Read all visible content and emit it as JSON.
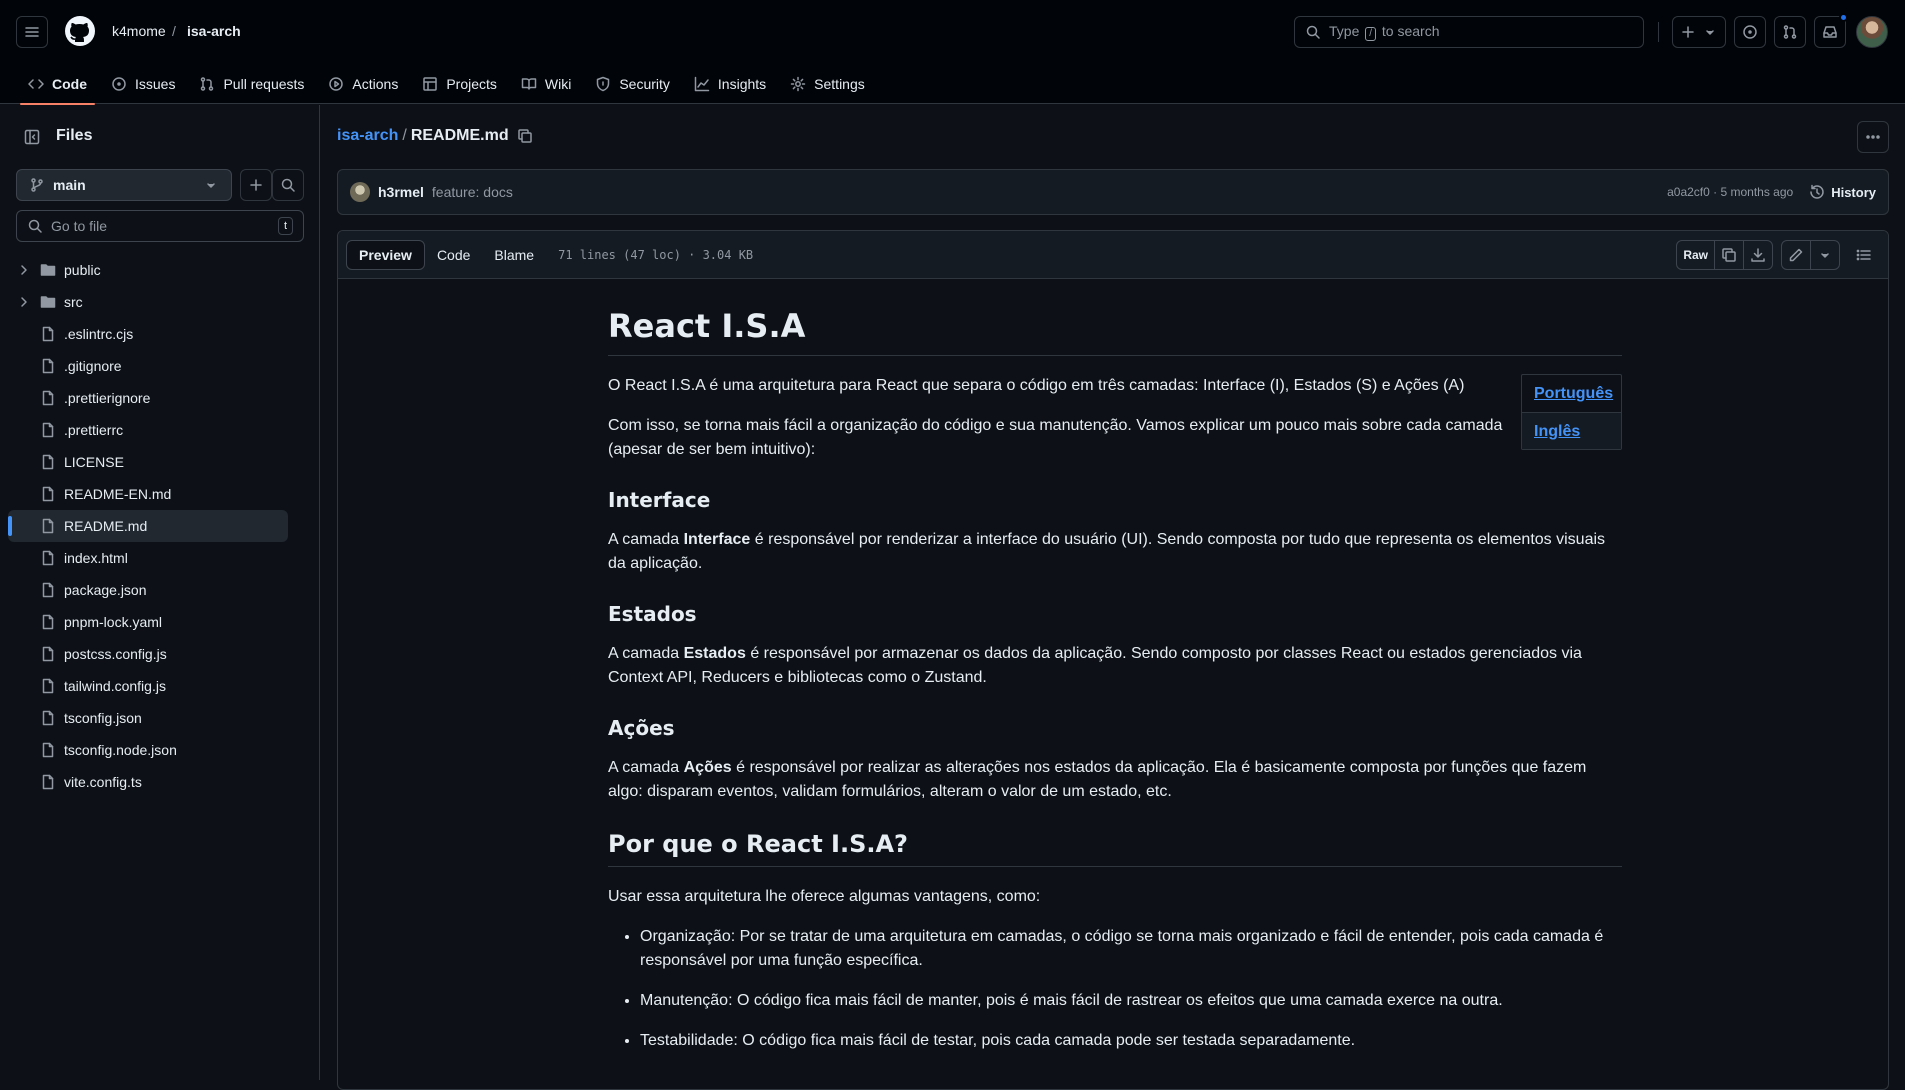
{
  "header": {
    "owner": "k4mome",
    "separator": "/",
    "repo": "isa-arch",
    "search": {
      "pre": "Type",
      "key": "/",
      "post": "to search"
    }
  },
  "nav_tabs": [
    {
      "label": "Code",
      "icon": "code-icon",
      "active": true
    },
    {
      "label": "Issues",
      "icon": "issue-icon"
    },
    {
      "label": "Pull requests",
      "icon": "pull-request-icon"
    },
    {
      "label": "Actions",
      "icon": "play-icon"
    },
    {
      "label": "Projects",
      "icon": "table-icon"
    },
    {
      "label": "Wiki",
      "icon": "book-icon"
    },
    {
      "label": "Security",
      "icon": "shield-icon"
    },
    {
      "label": "Insights",
      "icon": "graph-icon"
    },
    {
      "label": "Settings",
      "icon": "gear-icon"
    }
  ],
  "sidebar": {
    "title": "Files",
    "branch": "main",
    "goto_placeholder": "Go to file",
    "goto_key": "t",
    "items": [
      {
        "name": "public",
        "type": "folder"
      },
      {
        "name": "src",
        "type": "folder"
      },
      {
        "name": ".eslintrc.cjs",
        "type": "file"
      },
      {
        "name": ".gitignore",
        "type": "file"
      },
      {
        "name": ".prettierignore",
        "type": "file"
      },
      {
        "name": ".prettierrc",
        "type": "file"
      },
      {
        "name": "LICENSE",
        "type": "file"
      },
      {
        "name": "README-EN.md",
        "type": "file"
      },
      {
        "name": "README.md",
        "type": "file",
        "selected": true
      },
      {
        "name": "index.html",
        "type": "file"
      },
      {
        "name": "package.json",
        "type": "file"
      },
      {
        "name": "pnpm-lock.yaml",
        "type": "file"
      },
      {
        "name": "postcss.config.js",
        "type": "file"
      },
      {
        "name": "tailwind.config.js",
        "type": "file"
      },
      {
        "name": "tsconfig.json",
        "type": "file"
      },
      {
        "name": "tsconfig.node.json",
        "type": "file"
      },
      {
        "name": "vite.config.ts",
        "type": "file"
      }
    ]
  },
  "main": {
    "breadcrumb_repo": "isa-arch",
    "breadcrumb_sep": "/",
    "breadcrumb_file": "README.md",
    "commit": {
      "author": "h3rmel",
      "message": "feature: docs",
      "meta": "a0a2cf0 · 5 months ago",
      "history_label": "History"
    },
    "toolbar": {
      "preview": "Preview",
      "code": "Code",
      "blame": "Blame",
      "info": "71 lines (47 loc) · 3.04 KB",
      "raw": "Raw"
    },
    "readme": {
      "title": "React I.S.A",
      "intro_1": "O React I.S.A é uma arquitetura para React que separa o código em três camadas: Interface (I), Estados (S) e Ações (A)",
      "intro_2": "Com isso, se torna mais fácil a organização do código e sua manutenção. Vamos explicar um pouco mais sobre cada camada (apesar de ser bem intuitivo):",
      "lang_pt": "Português",
      "lang_en": "Inglês",
      "interface_title": "Interface",
      "interface_pre": "A camada",
      "interface_bold": "Interface",
      "interface_post": "é responsável por renderizar a interface do usuário (UI). Sendo composta por tudo que representa os elementos visuais da aplicação.",
      "estados_title": "Estados",
      "estados_pre": "A camada",
      "estados_bold": "Estados",
      "estados_post": "é responsável por armazenar os dados da aplicação. Sendo composto por classes React ou estados gerenciados via Context API, Reducers e bibliotecas como o Zustand.",
      "acoes_title": "Ações",
      "acoes_pre": "A camada",
      "acoes_bold": "Ações",
      "acoes_post": "é responsável por realizar as alterações nos estados da aplicação. Ela é basicamente composta por funções que fazem algo: disparam eventos, validam formulários, alteram o valor de um estado, etc.",
      "why_title": "Por que o React I.S.A?",
      "why_intro": "Usar essa arquitetura lhe oferece algumas vantagens, como:",
      "benefits": [
        "Organização: Por se tratar de uma arquitetura em camadas, o código se torna mais organizado e fácil de entender, pois cada camada é responsável por uma função específica.",
        "Manutenção: O código fica mais fácil de manter, pois é mais fácil de rastrear os efeitos que uma camada exerce na outra.",
        "Testabilidade: O código fica mais fácil de testar, pois cada camada pode ser testada separadamente."
      ]
    }
  }
}
